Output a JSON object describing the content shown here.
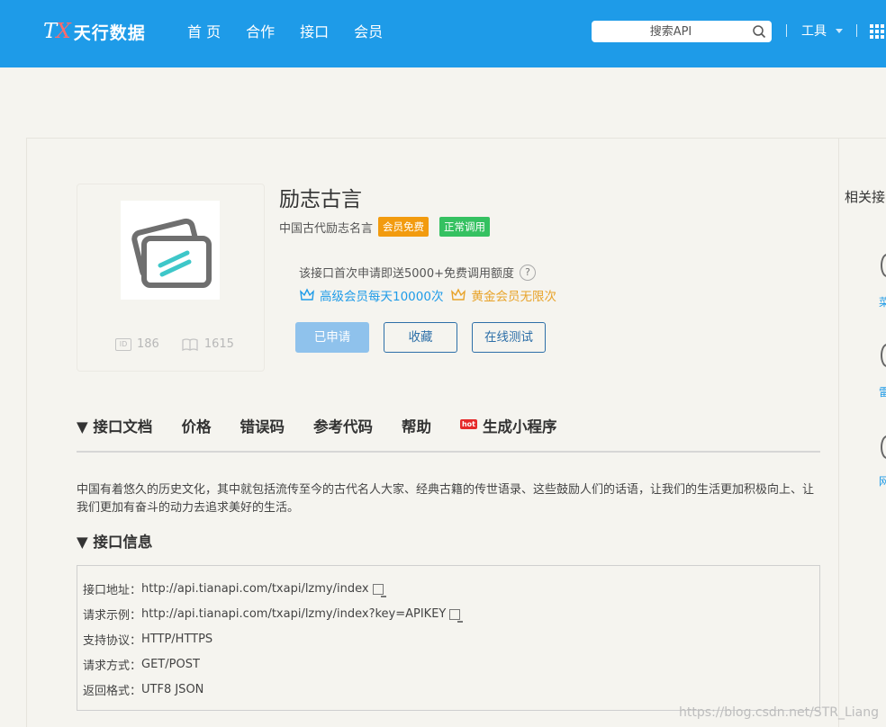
{
  "header": {
    "logo_mark": "TX",
    "logo_text": "天行数据",
    "nav": [
      "首 页",
      "合作",
      "接口",
      "会员"
    ],
    "search_placeholder": "搜索API",
    "tools_label": "工具"
  },
  "api": {
    "title": "励志古言",
    "subtitle": "中国古代励志名言",
    "badge_free": "会员免费",
    "badge_status": "正常调用",
    "id_value": "186",
    "views_value": "1615",
    "quota_text": "该接口首次申请即送5000+免费调用额度",
    "help_label": "?",
    "vip_senior": "高级会员每天10000次",
    "vip_gold": "黄金会员无限次",
    "buttons": {
      "applied": "已申请",
      "favorite": "收藏",
      "online_test": "在线测试"
    }
  },
  "tabs": [
    "▼ 接口文档",
    "价格",
    "错误码",
    "参考代码",
    "帮助",
    "生成小程序"
  ],
  "tab_hot_label": "hot",
  "description": "中国有着悠久的历史文化，其中就包括流传至今的古代名人大家、经典古籍的传世语录、这些鼓励人们的话语，让我们的生活更加积极向上、让我们更加有奋斗的动力去追求美好的生活。",
  "info_section_title": "▼ 接口信息",
  "info": [
    {
      "label": "接口地址：",
      "value": "http://api.tianapi.com/txapi/lzmy/index"
    },
    {
      "label": "请求示例：",
      "value": "http://api.tianapi.com/txapi/lzmy/index?key=APIKEY"
    },
    {
      "label": "支持协议：",
      "value": "HTTP/HTTPS"
    },
    {
      "label": "请求方式：",
      "value": "GET/POST"
    },
    {
      "label": "返回格式：",
      "value": "UTF8 JSON"
    }
  ],
  "sidebar": {
    "title": "相关接",
    "items": [
      "菜",
      "雷",
      "网"
    ]
  },
  "watermark": "https://blog.csdn.net/STR_Liang",
  "colors": {
    "brand": "#1e9be8",
    "badge_free": "#f29b0f",
    "badge_status": "#35c161",
    "gold": "#e8a32a"
  },
  "icons": [
    "search-icon",
    "caret-down-icon",
    "apps-grid-icon",
    "api-card-icon",
    "id-icon",
    "book-icon",
    "help-icon",
    "crown-blue-icon",
    "crown-gold-icon",
    "hot-icon",
    "copy-icon"
  ]
}
